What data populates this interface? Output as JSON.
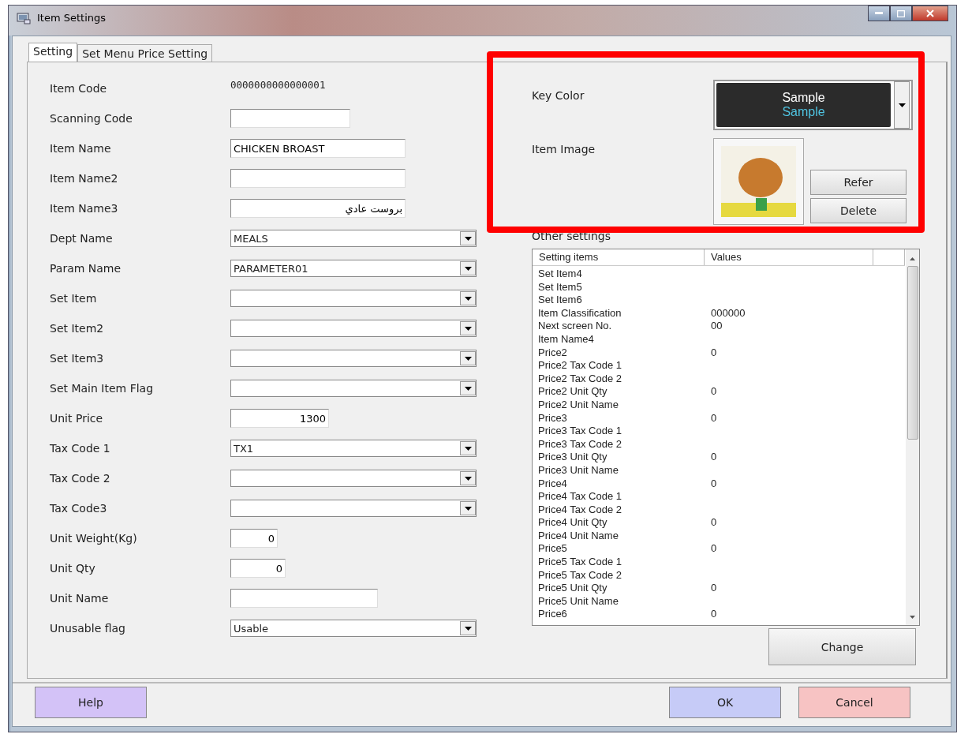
{
  "window": {
    "title": "Item Settings"
  },
  "tabs": [
    {
      "label": "Setting",
      "selected": true
    },
    {
      "label": "Set Menu Price Setting",
      "selected": false
    }
  ],
  "fields": [
    {
      "label": "Item Code",
      "kind": "static",
      "value": "0000000000000001"
    },
    {
      "label": "Scanning Code",
      "kind": "text"
    },
    {
      "label": "Item Name",
      "kind": "text",
      "value": "CHICKEN BROAST"
    },
    {
      "label": "Item Name2",
      "kind": "text"
    },
    {
      "label": "Item Name3",
      "kind": "text",
      "value": "بروست عادي"
    },
    {
      "label": "Dept Name",
      "kind": "combo",
      "value": "MEALS"
    },
    {
      "label": "Param Name",
      "kind": "combo",
      "value": "PARAMETER01"
    },
    {
      "label": "Set Item",
      "kind": "combo"
    },
    {
      "label": "Set Item2",
      "kind": "combo"
    },
    {
      "label": "Set Item3",
      "kind": "combo"
    },
    {
      "label": "Set Main Item Flag",
      "kind": "combo"
    },
    {
      "label": "Unit Price",
      "kind": "number",
      "value": "1300"
    },
    {
      "label": "Tax Code 1",
      "kind": "combo",
      "value": "TX1"
    },
    {
      "label": "Tax Code 2",
      "kind": "combo"
    },
    {
      "label": "Tax Code3",
      "kind": "combo"
    },
    {
      "label": "Unit Weight(Kg)",
      "kind": "number",
      "value": "0"
    },
    {
      "label": "Unit Qty",
      "kind": "number",
      "value": "0"
    },
    {
      "label": "Unit Name",
      "kind": "text"
    },
    {
      "label": "Unusable flag",
      "kind": "combo",
      "value": "Usable"
    }
  ],
  "key_color": {
    "label": "Key Color",
    "sample_top": "Sample",
    "sample_bottom": "Sample"
  },
  "item_image": {
    "label": "Item Image",
    "buttons": [
      "Refer",
      "Delete"
    ]
  },
  "other_settings": {
    "label": "Other settings",
    "columns": [
      "Setting items",
      "Values"
    ],
    "rows": [
      {
        "item": "Set Item4"
      },
      {
        "item": "Set Item5"
      },
      {
        "item": "Set Item6"
      },
      {
        "item": "Item Classification",
        "value": "000000"
      },
      {
        "item": "Next screen No.",
        "value": "00"
      },
      {
        "item": "Item Name4"
      },
      {
        "item": "Price2",
        "value": "0"
      },
      {
        "item": "Price2 Tax Code 1"
      },
      {
        "item": "Price2 Tax Code 2"
      },
      {
        "item": "Price2 Unit Qty",
        "value": "0"
      },
      {
        "item": "Price2 Unit Name"
      },
      {
        "item": "Price3",
        "value": "0"
      },
      {
        "item": "Price3 Tax Code 1"
      },
      {
        "item": "Price3 Tax Code 2"
      },
      {
        "item": "Price3 Unit Qty",
        "value": "0"
      },
      {
        "item": "Price3 Unit Name"
      },
      {
        "item": "Price4",
        "value": "0"
      },
      {
        "item": "Price4 Tax Code 1"
      },
      {
        "item": "Price4 Tax Code 2"
      },
      {
        "item": "Price4 Unit Qty",
        "value": "0"
      },
      {
        "item": "Price4 Unit Name"
      },
      {
        "item": "Price5",
        "value": "0"
      },
      {
        "item": "Price5 Tax Code 1"
      },
      {
        "item": "Price5 Tax Code 2"
      },
      {
        "item": "Price5 Unit Qty",
        "value": "0"
      },
      {
        "item": "Price5 Unit Name"
      },
      {
        "item": "Price6",
        "value": "0"
      }
    ],
    "button": "Change"
  },
  "footer_buttons": [
    {
      "label": "Help",
      "kind": "help"
    },
    {
      "label": "OK",
      "kind": "ok"
    },
    {
      "label": "Cancel",
      "kind": "cancel"
    }
  ]
}
